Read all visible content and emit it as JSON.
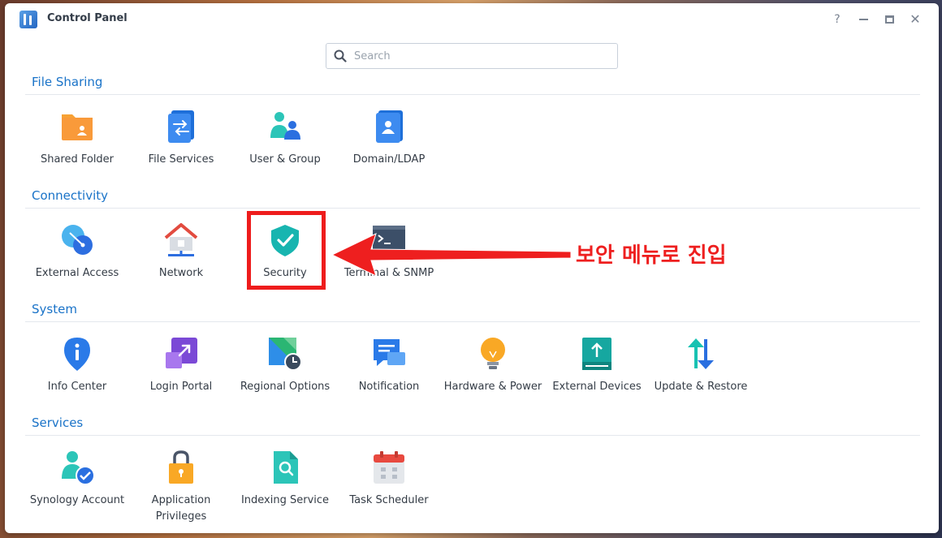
{
  "window": {
    "title": "Control Panel",
    "controls": {
      "help": "?",
      "close": "✕"
    }
  },
  "search": {
    "placeholder": "Search",
    "value": ""
  },
  "sections": {
    "file_sharing": {
      "title": "File Sharing",
      "items": [
        {
          "label": "Shared Folder",
          "icon": "shared-folder-icon"
        },
        {
          "label": "File Services",
          "icon": "file-services-icon"
        },
        {
          "label": "User & Group",
          "icon": "user-group-icon"
        },
        {
          "label": "Domain/LDAP",
          "icon": "domain-ldap-icon"
        }
      ]
    },
    "connectivity": {
      "title": "Connectivity",
      "items": [
        {
          "label": "External Access",
          "icon": "external-access-icon"
        },
        {
          "label": "Network",
          "icon": "network-icon"
        },
        {
          "label": "Security",
          "icon": "security-shield-icon"
        },
        {
          "label": "Terminal & SNMP",
          "icon": "terminal-icon"
        }
      ]
    },
    "system": {
      "title": "System",
      "items": [
        {
          "label": "Info Center",
          "icon": "info-center-icon"
        },
        {
          "label": "Login Portal",
          "icon": "login-portal-icon"
        },
        {
          "label": "Regional Options",
          "icon": "regional-options-icon"
        },
        {
          "label": "Notification",
          "icon": "notification-icon"
        },
        {
          "label": "Hardware & Power",
          "icon": "hardware-power-icon"
        },
        {
          "label": "External Devices",
          "icon": "external-devices-icon"
        },
        {
          "label": "Update & Restore",
          "icon": "update-restore-icon"
        }
      ]
    },
    "services": {
      "title": "Services",
      "items": [
        {
          "label": "Synology Account",
          "icon": "synology-account-icon"
        },
        {
          "label": "Application Privileges",
          "icon": "application-privileges-icon"
        },
        {
          "label": "Indexing Service",
          "icon": "indexing-service-icon"
        },
        {
          "label": "Task Scheduler",
          "icon": "task-scheduler-icon"
        }
      ]
    }
  },
  "annotation": {
    "text": "보안 메뉴로 진입",
    "color": "#ee1f1f"
  },
  "colors": {
    "section_title": "#1a73c8",
    "accent": "#1a73c8",
    "highlight": "#ee1c1c"
  }
}
